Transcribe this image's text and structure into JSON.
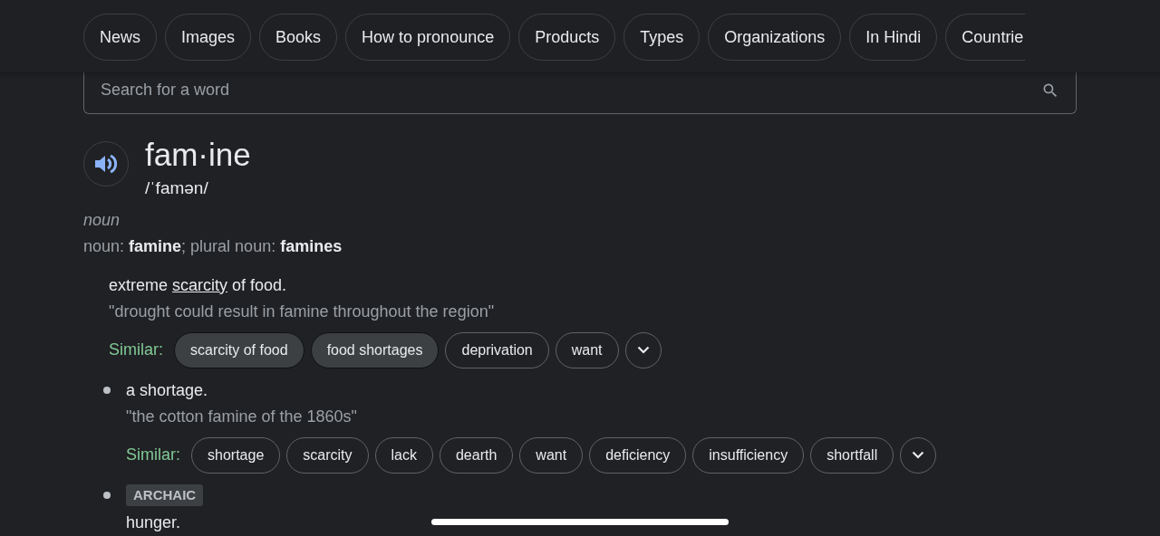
{
  "chips": [
    {
      "label": "News"
    },
    {
      "label": "Images"
    },
    {
      "label": "Books"
    },
    {
      "label": "How to pronounce"
    },
    {
      "label": "Products"
    },
    {
      "label": "Types"
    },
    {
      "label": "Organizations"
    },
    {
      "label": "In Hindi"
    },
    {
      "label": "Countrie"
    }
  ],
  "search": {
    "placeholder": "Search for a word"
  },
  "entry": {
    "word": "fam·ine",
    "phonetic": "/ˈfamən/",
    "part_of_speech": "noun",
    "forms": "noun: **famine**; plural noun: **famines**"
  },
  "senses": [
    {
      "bullet": false,
      "definition": [
        {
          "text": "extreme ",
          "link": false
        },
        {
          "text": "scarcity",
          "link": true
        },
        {
          "text": " of food.",
          "link": false
        }
      ],
      "example": "\"drought could result in famine throughout the region\"",
      "similar_label": "Similar:",
      "similar": [
        {
          "word": "scarcity of food",
          "highlighted": true
        },
        {
          "word": "food shortages",
          "highlighted": true
        },
        {
          "word": "deprivation",
          "highlighted": false
        },
        {
          "word": "want",
          "highlighted": false
        }
      ]
    },
    {
      "bullet": true,
      "definition": [
        {
          "text": "a shortage.",
          "link": false
        }
      ],
      "example": "\"the cotton famine of the 1860s\"",
      "similar_label": "Similar:",
      "similar": [
        {
          "word": "shortage",
          "highlighted": false
        },
        {
          "word": "scarcity",
          "highlighted": false
        },
        {
          "word": "lack",
          "highlighted": false
        },
        {
          "word": "dearth",
          "highlighted": false
        },
        {
          "word": "want",
          "highlighted": false
        },
        {
          "word": "deficiency",
          "highlighted": false
        },
        {
          "word": "insufficiency",
          "highlighted": false
        },
        {
          "word": "shortfall",
          "highlighted": false
        }
      ]
    },
    {
      "bullet": true,
      "label": "ARCHAIC",
      "definition": [
        {
          "text": "hunger.",
          "link": false
        }
      ]
    }
  ]
}
